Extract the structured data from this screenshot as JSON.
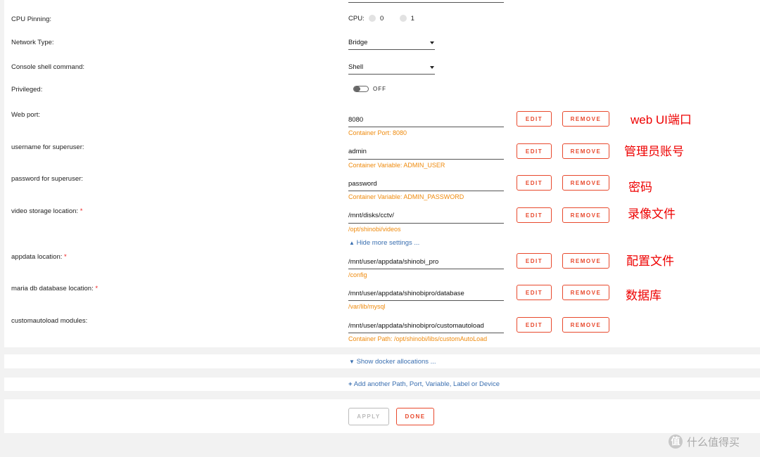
{
  "rows": {
    "cpu": {
      "label": "CPU Pinning:",
      "prefix": "CPU:",
      "options": [
        "0",
        "1"
      ]
    },
    "network": {
      "label": "Network Type:",
      "value": "Bridge"
    },
    "console": {
      "label": "Console shell command:",
      "value": "Shell"
    },
    "privileged": {
      "label": "Privileged:",
      "state": "OFF"
    },
    "webport": {
      "label": "Web port:",
      "value": "8080",
      "hint": "Container Port: 8080",
      "annotation": "web UI端口"
    },
    "username": {
      "label": "username for superuser:",
      "value": "admin",
      "hint": "Container Variable: ADMIN_USER",
      "annotation": "管理员账号"
    },
    "password": {
      "label": "password for superuser:",
      "value": "password",
      "hint": "Container Variable: ADMIN_PASSWORD",
      "annotation": "密码"
    },
    "video": {
      "label": "video storage location:",
      "required": "*",
      "value": "/mnt/disks/cctv/",
      "hint": "/opt/shinobi/videos",
      "annotation": "录像文件"
    },
    "appdata": {
      "label": "appdata location:",
      "required": "*",
      "value": "/mnt/user/appdata/shinobi_pro",
      "hint": "/config",
      "annotation": "配置文件"
    },
    "mariadb": {
      "label": "maria db database location:",
      "required": "*",
      "value": "/mnt/user/appdata/shinobipro/database",
      "hint": "/var/lib/mysql",
      "annotation": "数据库"
    },
    "autoload": {
      "label": "customautoload modules:",
      "value": "/mnt/user/appdata/shinobipro/customautoload",
      "hint": "Container Path: /opt/shinobi/libs/customAutoLoad"
    }
  },
  "buttons": {
    "edit": "EDIT",
    "remove": "REMOVE",
    "apply": "APPLY",
    "done": "DONE"
  },
  "links": {
    "hide_more": "Hide more settings ...",
    "show_docker": "Show docker allocations ...",
    "add_another": "Add another Path, Port, Variable, Label or Device"
  },
  "watermark": "什么值得买",
  "colors": {
    "accent": "#e8492d",
    "hint": "#ef8a0c",
    "link": "#3a6fb0",
    "annotation": "#e00000"
  }
}
